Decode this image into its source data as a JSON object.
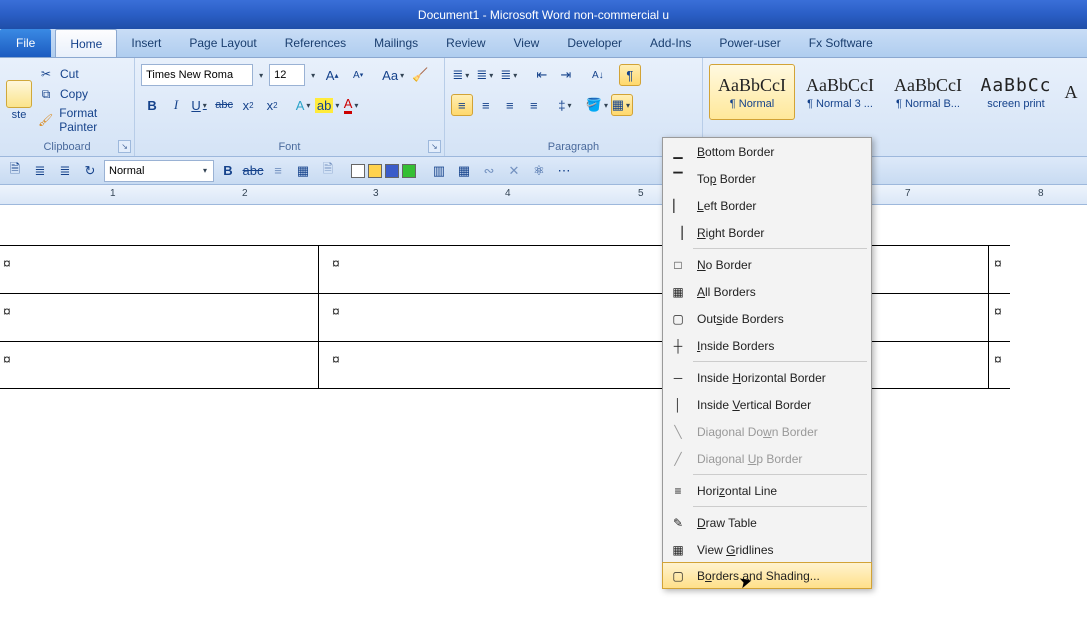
{
  "title": "Document1 - Microsoft Word non-commercial u",
  "tabs": {
    "file": "File",
    "list": [
      "Home",
      "Insert",
      "Page Layout",
      "References",
      "Mailings",
      "Review",
      "View",
      "Developer",
      "Add-Ins",
      "Power-user",
      "Fx Software"
    ],
    "active": "Home"
  },
  "clipboard": {
    "paste": "ste",
    "cut": "Cut",
    "copy": "Copy",
    "format_painter": "Format Painter",
    "label": "Clipboard"
  },
  "font": {
    "name": "Times New Roma",
    "size": "12",
    "label": "Font"
  },
  "paragraph": {
    "label": "Paragraph"
  },
  "styles": [
    {
      "preview": "AaBbCcI",
      "name": "¶ Normal",
      "hl": true
    },
    {
      "preview": "AaBbCcI",
      "name": "¶ Normal 3 ...",
      "hl": false
    },
    {
      "preview": "AaBbCcI",
      "name": "¶ Normal B...",
      "hl": false
    },
    {
      "preview": "AaBbCc",
      "name": "screen print",
      "hl": false,
      "mono": true
    },
    {
      "preview": "A",
      "name": "",
      "hl": false
    }
  ],
  "qat": {
    "combo": "Normal"
  },
  "ruler_ticks": [
    "1",
    "2",
    "3",
    "4",
    "5",
    "7",
    "8"
  ],
  "border_menu": {
    "bottom": "Bottom Border",
    "top": "Top Border",
    "left": "Left Border",
    "right": "Right Border",
    "none": "No Border",
    "all": "All Borders",
    "outside": "Outside Borders",
    "inside": "Inside Borders",
    "ih": "Inside Horizontal Border",
    "iv": "Inside Vertical Border",
    "dd": "Diagonal Down Border",
    "du": "Diagonal Up Border",
    "hl": "Horizontal Line",
    "draw": "Draw Table",
    "grid": "View Gridlines",
    "bs": "Borders and Shading..."
  }
}
